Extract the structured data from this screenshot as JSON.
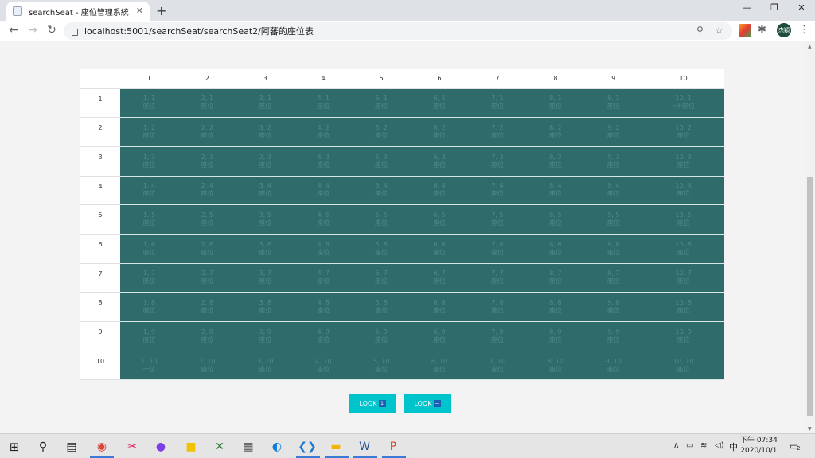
{
  "browser": {
    "tab_title": "searchSeat - 座位管理系統",
    "tab_close": "✕",
    "new_tab": "+",
    "url": "localhost:5001/searchSeat/searchSeat2/阿蕃的座位表",
    "profile_label": "杰穎",
    "win_min": "—",
    "win_restore": "❐",
    "win_close": "✕"
  },
  "table": {
    "columns": [
      "1",
      "2",
      "3",
      "4",
      "5",
      "6",
      "7",
      "8",
      "9",
      "10"
    ],
    "rows": [
      "1",
      "2",
      "3",
      "4",
      "5",
      "6",
      "7",
      "8",
      "9",
      "10"
    ],
    "cells": [
      [
        "1, 1|座位",
        "2, 1|座位",
        "3, 1|座位",
        "4, 1|座位",
        "5, 1|座位",
        "6, 1|座位",
        "7, 1|座位",
        "8, 1|座位",
        "9, 1|座位",
        "10, 1|k十座位"
      ],
      [
        "1, 2|座位",
        "2, 2|座位",
        "3, 2|座位",
        "4, 2|座位",
        "5, 2|座位",
        "6, 2|座位",
        "7, 2|座位",
        "8, 2|座位",
        "9, 2|座位",
        "10, 2|座位"
      ],
      [
        "1, 3|座位",
        "2, 3|座位",
        "3, 3|座位",
        "4, 3|座位",
        "5, 3|座位",
        "6, 3|座位",
        "7, 3|座位",
        "8, 3|座位",
        "9, 3|座位",
        "10, 3|座位"
      ],
      [
        "1, 4|座位",
        "2, 4|座位",
        "3, 4|座位",
        "4, 4|座位",
        "5, 4|座位",
        "6, 4|座位",
        "7, 4|座位",
        "8, 4|座位",
        "9, 4|座位",
        "10, 4|座位"
      ],
      [
        "1, 5|座位",
        "2, 5|座位",
        "3, 5|座位",
        "4, 5|座位",
        "5, 5|座位",
        "6, 5|座位",
        "7, 5|座位",
        "8, 5|座位",
        "9, 5|座位",
        "10, 5|座位"
      ],
      [
        "1, 6|座位",
        "2, 6|座位",
        "3, 6|座位",
        "4, 6|座位",
        "5, 6|座位",
        "6, 6|座位",
        "7, 6|座位",
        "8, 6|座位",
        "9, 6|座位",
        "10, 6|座位"
      ],
      [
        "1, 7|座位",
        "2, 7|座位",
        "3, 7|座位",
        "4, 7|座位",
        "5, 7|座位",
        "6, 7|座位",
        "7, 7|座位",
        "8, 7|座位",
        "9, 7|座位",
        "10, 7|座位"
      ],
      [
        "1, 8|座位",
        "2, 8|座位",
        "3, 8|座位",
        "4, 8|座位",
        "5, 8|座位",
        "6, 8|座位",
        "7, 8|座位",
        "8, 8|座位",
        "9, 8|座位",
        "10, 8|座位"
      ],
      [
        "1, 9|座位",
        "2, 9|座位",
        "3, 9|座位",
        "4, 9|座位",
        "5, 9|座位",
        "6, 9|座位",
        "7, 9|座位",
        "8, 9|座位",
        "9, 9|座位",
        "10, 9|座位"
      ],
      [
        "1, 10|十位",
        "2, 10|座位",
        "3, 10|座位",
        "4, 10|座位",
        "5, 10|座位",
        "6, 10|座位",
        "7, 10|座位",
        "8, 10|座位",
        "9, 10|座位",
        "10, 10|座位"
      ]
    ],
    "cell_color": "#2f6b6b"
  },
  "buttons": {
    "look1_label": "LOOK",
    "look1_icon": "1",
    "look2_label": "LOOK",
    "look2_icon": "—",
    "accent": "#00c4cc"
  },
  "taskbar": {
    "ime": "中",
    "time": "下午 07:34",
    "date": "2020/10/1",
    "notification_count": "2"
  }
}
